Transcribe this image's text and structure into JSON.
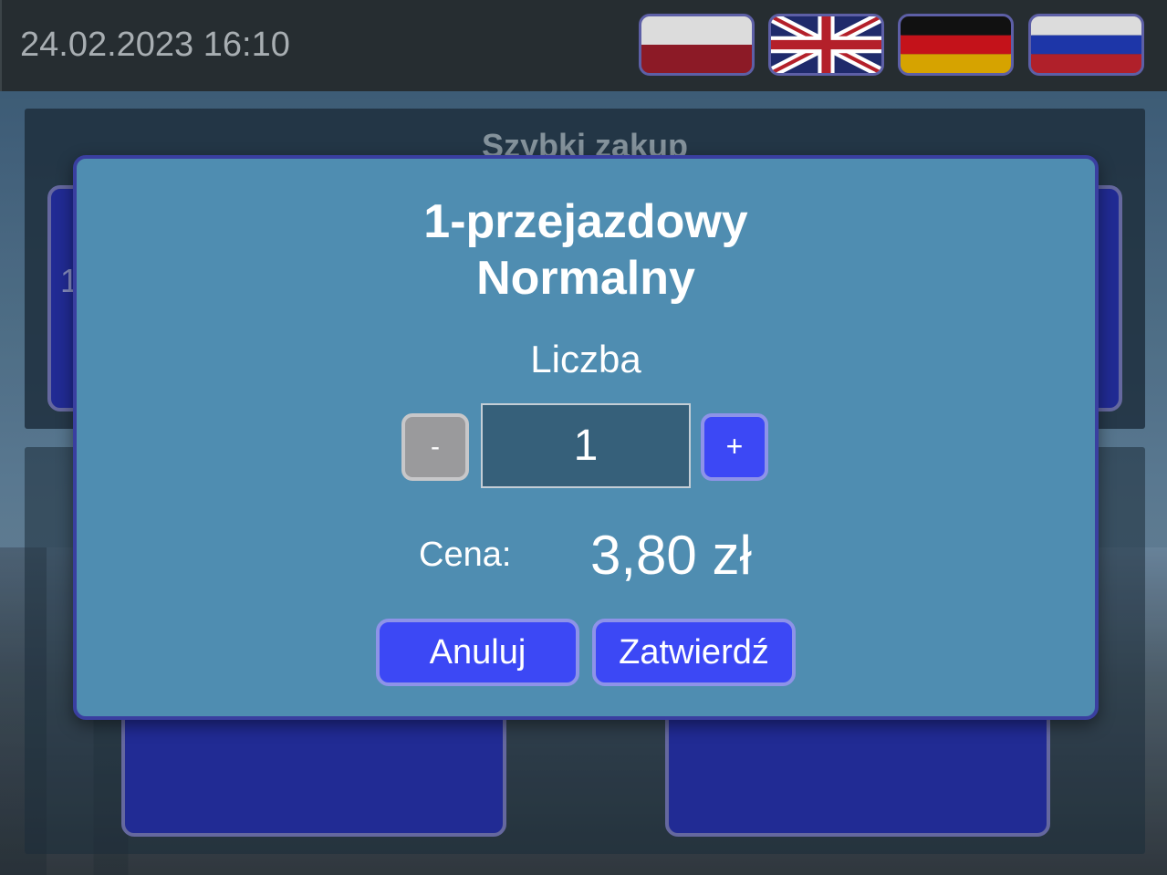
{
  "header": {
    "datetime": "24.02.2023 16:10",
    "languages": [
      {
        "code": "pl",
        "icon": "poland-flag-icon"
      },
      {
        "code": "en",
        "icon": "uk-flag-icon"
      },
      {
        "code": "de",
        "icon": "germany-flag-icon"
      },
      {
        "code": "ru",
        "icon": "russia-flag-icon"
      }
    ]
  },
  "background": {
    "quick_purchase_title": "Szybki zakup",
    "first_tile_visible_text": "1"
  },
  "dialog": {
    "title_line1": "1-przejazdowy",
    "title_line2": "Normalny",
    "quantity_label": "Liczba",
    "minus_label": "-",
    "quantity_value": "1",
    "plus_label": "+",
    "price_label": "Cena:",
    "price_value": "3,80 zł",
    "cancel_label": "Anuluj",
    "confirm_label": "Zatwierdź"
  },
  "colors": {
    "dialog_bg": "#4f8db1",
    "button_blue": "#3c48f5",
    "button_disabled": "#9a9a9c",
    "topbar": "#262d31"
  }
}
